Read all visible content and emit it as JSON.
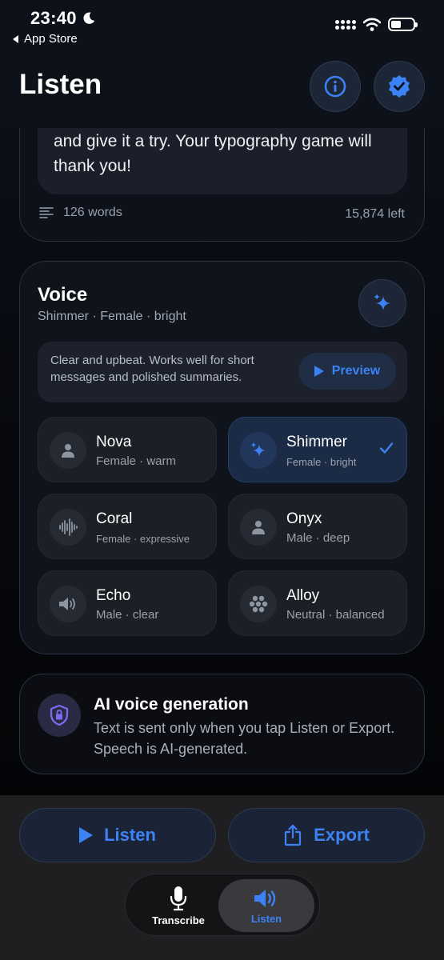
{
  "status_bar": {
    "time": "23:40",
    "back_app": "App Store",
    "battery_fraction": 0.45
  },
  "header": {
    "title": "Listen",
    "info_icon": "info-icon",
    "badge_icon": "verified-badge-icon"
  },
  "text_card": {
    "body": "and give it a try. Your typography game will thank you!",
    "word_count": "126 words",
    "remaining": "15,874 left"
  },
  "voice": {
    "title": "Voice",
    "subtitle": "Shimmer · Female · bright",
    "description": "Clear and upbeat. Works well for short messages and polished summaries.",
    "preview_label": "Preview",
    "options": [
      {
        "name": "Nova",
        "desc": "Female · warm",
        "icon": "person-icon",
        "selected": false
      },
      {
        "name": "Shimmer",
        "desc": "Female · bright",
        "icon": "sparkles-icon",
        "selected": true
      },
      {
        "name": "Coral",
        "desc": "Female · expressive",
        "icon": "waveform-icon",
        "selected": false
      },
      {
        "name": "Onyx",
        "desc": "Male · deep",
        "icon": "person-icon",
        "selected": false
      },
      {
        "name": "Echo",
        "desc": "Male · clear",
        "icon": "speaker-icon",
        "selected": false
      },
      {
        "name": "Alloy",
        "desc": "Neutral · balanced",
        "icon": "hexagon-dots-icon",
        "selected": false
      }
    ]
  },
  "ai_notice": {
    "title": "AI voice generation",
    "text": "Text is sent only when you tap Listen or Export. Speech is AI-generated."
  },
  "actions": {
    "listen_label": "Listen",
    "export_label": "Export"
  },
  "tabs": [
    {
      "label": "Transcribe",
      "icon": "microphone-icon",
      "active": false
    },
    {
      "label": "Listen",
      "icon": "speaker-wave-icon",
      "active": true
    }
  ],
  "colors": {
    "accent": "#3d82f4",
    "background": "#07090e",
    "card": "#1c1f26",
    "selected_card": "#1b2b45"
  }
}
